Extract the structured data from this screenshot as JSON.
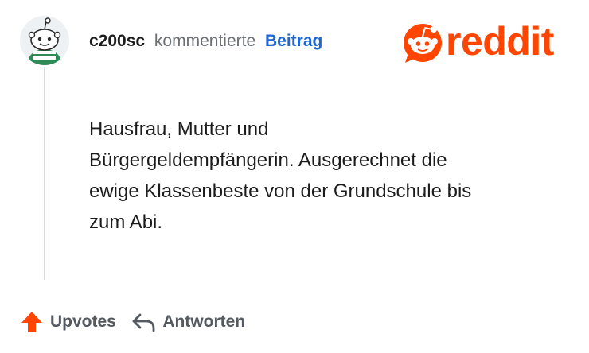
{
  "comment": {
    "username": "c200sc",
    "action": "kommentierte",
    "target": "Beitrag",
    "text_lines": [
      "Hausfrau, Mutter und",
      "Bürgergeldempfängerin. Ausgerechnet die",
      "ewige Klassenbeste von der Grundschule bis",
      "zum Abi."
    ]
  },
  "brand": {
    "wordmark": "reddit",
    "color": "#ff4500"
  },
  "actions": {
    "upvote_label": "Upvotes",
    "reply_label": "Antworten"
  },
  "icons": {
    "avatar": "snoo-avatar",
    "logo": "reddit-snoo-icon",
    "upvote": "upvote-arrow-icon",
    "reply": "reply-arrow-icon"
  }
}
